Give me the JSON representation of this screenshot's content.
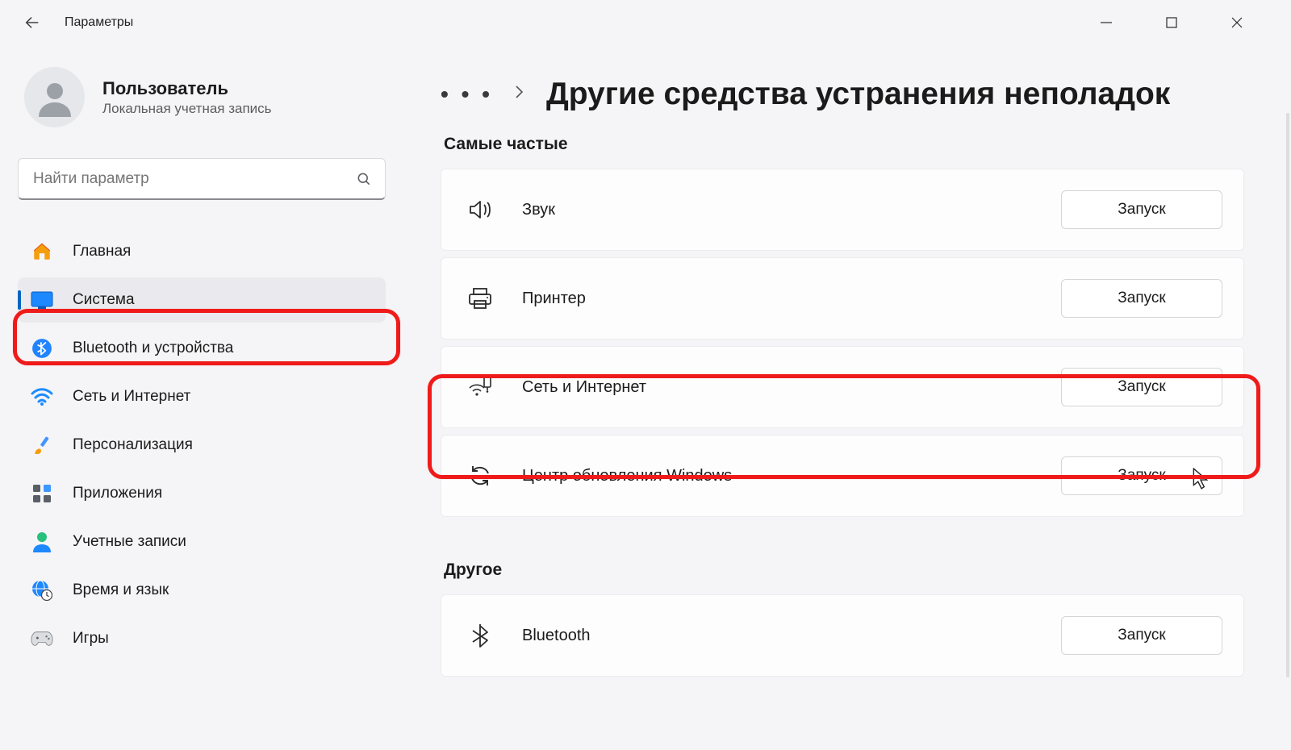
{
  "app": {
    "title": "Параметры"
  },
  "user": {
    "name": "Пользователь",
    "subtitle": "Локальная учетная запись"
  },
  "search": {
    "placeholder": "Найти параметр"
  },
  "sidebar": {
    "items": [
      {
        "key": "home",
        "label": "Главная"
      },
      {
        "key": "system",
        "label": "Система"
      },
      {
        "key": "bluetooth",
        "label": "Bluetooth и устройства"
      },
      {
        "key": "network",
        "label": "Сеть и Интернет"
      },
      {
        "key": "personalization",
        "label": "Персонализация"
      },
      {
        "key": "apps",
        "label": "Приложения"
      },
      {
        "key": "accounts",
        "label": "Учетные записи"
      },
      {
        "key": "time",
        "label": "Время и язык"
      },
      {
        "key": "gaming",
        "label": "Игры"
      }
    ]
  },
  "breadcrumb": {
    "title": "Другие средства устранения неполадок"
  },
  "sections": {
    "frequent": {
      "title": "Самые частые",
      "items": [
        {
          "key": "audio",
          "label": "Звук",
          "action": "Запуск"
        },
        {
          "key": "printer",
          "label": "Принтер",
          "action": "Запуск"
        },
        {
          "key": "network",
          "label": "Сеть и Интернет",
          "action": "Запуск"
        },
        {
          "key": "update",
          "label": "Центр обновления Windows",
          "action": "Запуск"
        }
      ]
    },
    "other": {
      "title": "Другое",
      "items": [
        {
          "key": "bluetooth",
          "label": "Bluetooth",
          "action": "Запуск"
        }
      ]
    }
  },
  "annotations": {
    "highlighted_sidebar_item": "system",
    "highlighted_card": "network"
  }
}
